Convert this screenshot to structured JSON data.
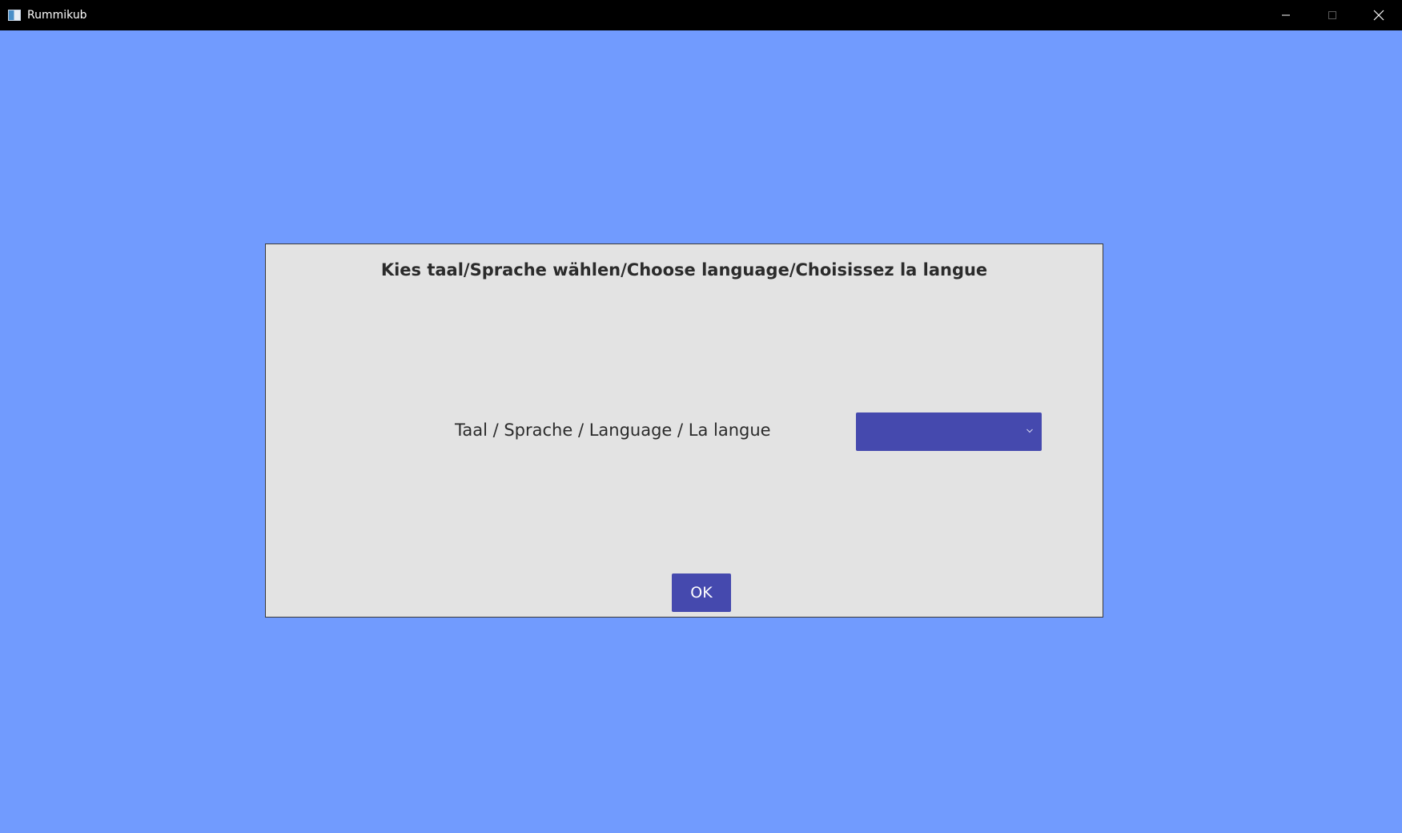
{
  "window": {
    "title": "Rummikub",
    "icon": "app-window-icon",
    "background_color": "#719bfe",
    "controls": [
      "minimize-icon",
      "maximize-icon",
      "close-icon"
    ]
  },
  "dialog": {
    "title": "Kies taal/Sprache wählen/Choose language/Choisissez la langue",
    "language_label": "Taal / Sprache / Language / La langue",
    "language_select": {
      "selected_value": "",
      "icon": "chevron-down-icon"
    },
    "ok_label": "OK",
    "accent_color": "#4549ae",
    "background_color": "#e3e3e3"
  }
}
